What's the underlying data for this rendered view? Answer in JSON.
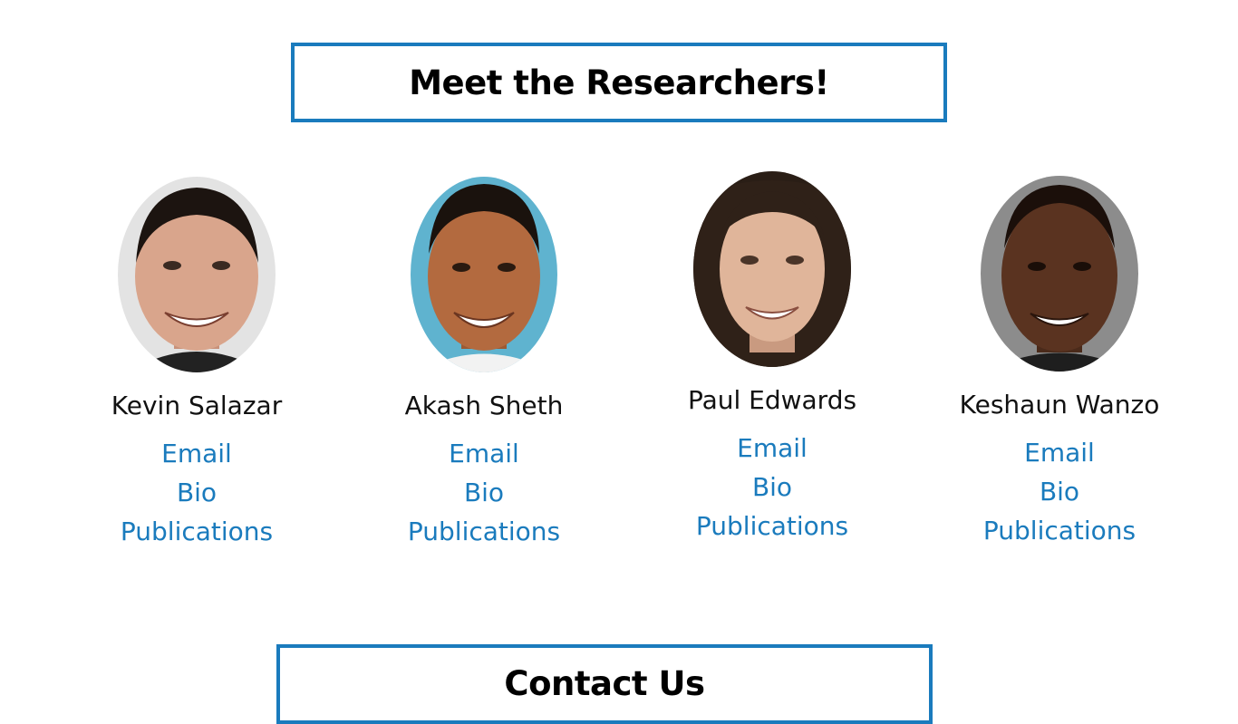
{
  "header": {
    "title": "Meet the Researchers!"
  },
  "researchers": [
    {
      "name": "Kevin Salazar",
      "email_label": "Email",
      "bio_label": "Bio",
      "publications_label": "Publications",
      "photo_bg": "#e3e3e3",
      "skin": "#d9a58c",
      "hair": "#1c1410"
    },
    {
      "name": "Akash Sheth",
      "email_label": "Email",
      "bio_label": "Bio",
      "publications_label": "Publications",
      "photo_bg": "#5fb3cf",
      "skin": "#b36a3f",
      "hair": "#1a120d"
    },
    {
      "name": "Paul Edwards",
      "email_label": "Email",
      "bio_label": "Bio",
      "publications_label": "Publications",
      "photo_bg": "#2a1e16",
      "skin": "#e0b59a",
      "hair": "#2f2118"
    },
    {
      "name": "Keshaun Wanzo",
      "email_label": "Email",
      "bio_label": "Bio",
      "publications_label": "Publications",
      "photo_bg": "#8c8c8c",
      "skin": "#5a3320",
      "hair": "#1b0f0a"
    }
  ],
  "contact": {
    "title": "Contact Us"
  },
  "colors": {
    "accent": "#1a7bbd",
    "text": "#111111"
  }
}
